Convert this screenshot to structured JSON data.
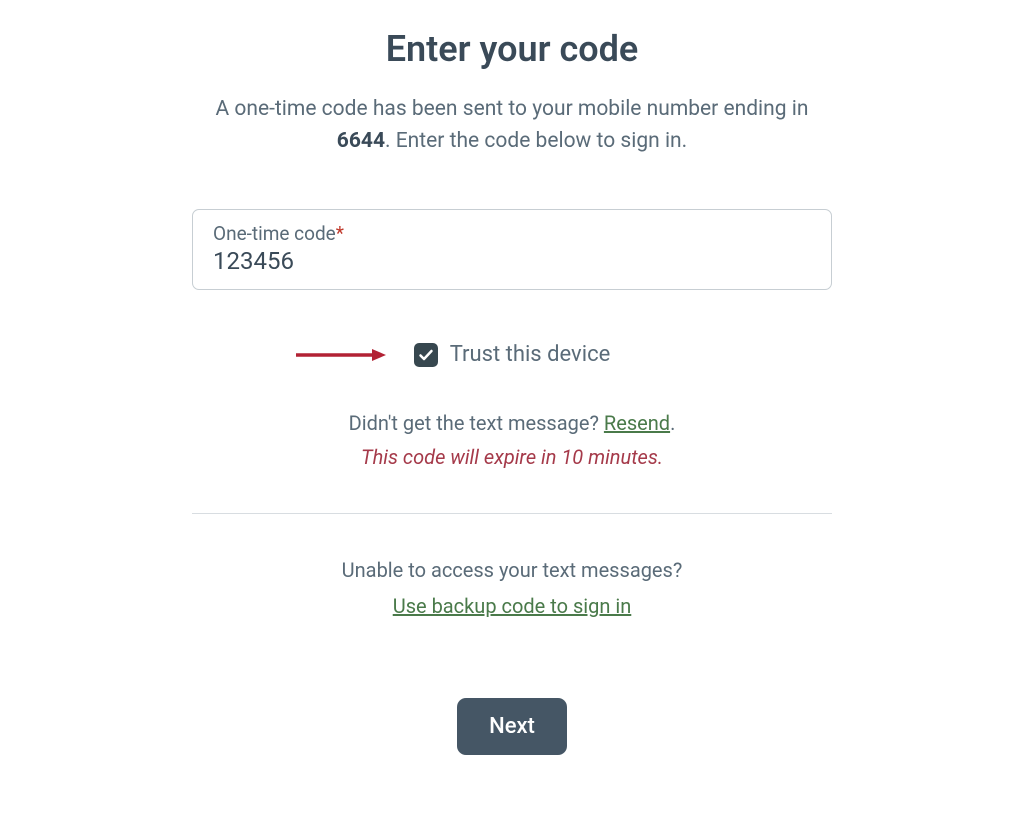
{
  "title": "Enter your code",
  "subtitle": {
    "prefix": "A one-time code has been sent to your mobile number ending in ",
    "last4": "6644",
    "suffix": ". Enter the code below to sign in."
  },
  "code_input": {
    "label": "One-time code",
    "required_mark": "*",
    "value": "123456"
  },
  "trust_device": {
    "checked": true,
    "label": "Trust this device"
  },
  "resend": {
    "prefix": "Didn't get the text message? ",
    "link": "Resend",
    "suffix": "."
  },
  "expire_text": "This code will expire in 10 minutes.",
  "unable_text": "Unable to access your text messages?",
  "backup_link": "Use backup code to sign in",
  "next_button": "Next",
  "colors": {
    "text_primary": "#3a4a58",
    "text_secondary": "#5a6b78",
    "link_green": "#4a7a4a",
    "warning_red": "#a53a4a",
    "arrow_red": "#b22234",
    "button_bg": "#455665"
  }
}
